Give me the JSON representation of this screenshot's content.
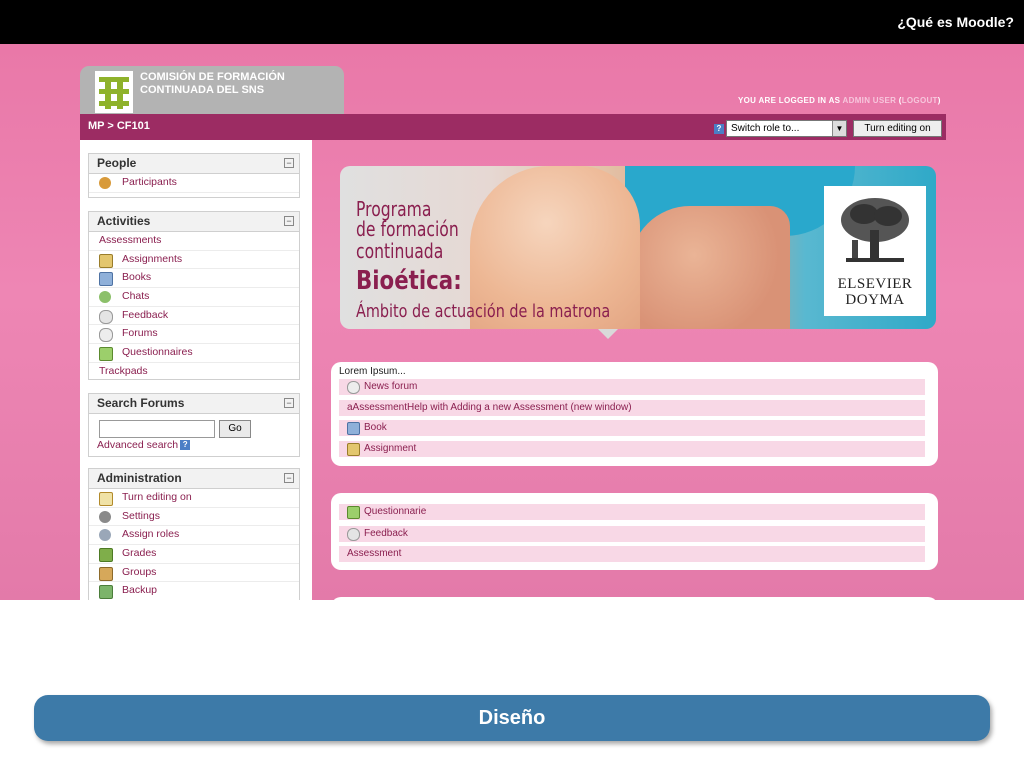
{
  "slide": {
    "title": "¿Qué es Moodle?",
    "caption": "Diseño"
  },
  "header": {
    "logo_text": "COMISIÓN DE FORMACIÓN CONTINUADA DEL SNS",
    "login_prefix": "YOU ARE LOGGED IN AS",
    "login_user": "ADMIN USER",
    "logout_open": "(",
    "logout": "LOGOUT",
    "logout_close": ")"
  },
  "navbar": {
    "breadcrumb": "MP > CF101",
    "help_icon": "?",
    "switch_role": "Switch role to...",
    "turn_editing_button": "Turn editing on"
  },
  "blocks": {
    "people": {
      "title": "People",
      "items": [
        {
          "label": "Participants",
          "icon": "users-icon"
        }
      ]
    },
    "activities": {
      "title": "Activities",
      "items": [
        {
          "label": "Assessments",
          "icon": ""
        },
        {
          "label": "Assignments",
          "icon": "assignment-icon"
        },
        {
          "label": "Books",
          "icon": "book-icon"
        },
        {
          "label": "Chats",
          "icon": "chat-icon"
        },
        {
          "label": "Feedback",
          "icon": "feedback-icon"
        },
        {
          "label": "Forums",
          "icon": "forum-icon"
        },
        {
          "label": "Questionnaires",
          "icon": "questionnaire-icon"
        },
        {
          "label": "Trackpads",
          "icon": ""
        }
      ]
    },
    "search_forums": {
      "title": "Search Forums",
      "go": "Go",
      "advanced": "Advanced search",
      "help": "?"
    },
    "administration": {
      "title": "Administration",
      "items": [
        {
          "label": "Turn editing on",
          "icon": "edit-icon"
        },
        {
          "label": "Settings",
          "icon": "settings-icon"
        },
        {
          "label": "Assign roles",
          "icon": "roles-icon"
        },
        {
          "label": "Grades",
          "icon": "grades-icon"
        },
        {
          "label": "Groups",
          "icon": "groups-icon"
        },
        {
          "label": "Backup",
          "icon": "backup-icon"
        }
      ]
    },
    "collapse_symbol": "−"
  },
  "banner": {
    "line1": "Programa",
    "line2": "de formación",
    "line3": "continuada",
    "title": "Bioética:",
    "subtitle": "Ámbito de actuación de la matrona",
    "publisher_line1": "ELSEVIER",
    "publisher_line2": "DOYMA"
  },
  "section1": {
    "header": "Lorem Ipsum...",
    "items": [
      {
        "label": "News forum",
        "icon": "forum-icon"
      },
      {
        "label": "aAssessmentHelp with Adding a new Assessment (new window)",
        "icon": ""
      },
      {
        "label": "Book",
        "icon": "book-icon"
      },
      {
        "label": "Assignment",
        "icon": "assignment-icon"
      }
    ]
  },
  "section2": {
    "items": [
      {
        "label": "Questionnarie",
        "icon": "questionnaire-icon"
      },
      {
        "label": "Feedback",
        "icon": "feedback-icon"
      },
      {
        "label": "Assessment",
        "icon": ""
      }
    ]
  },
  "colors": {
    "navbar": "#9c2c63",
    "link": "#8a1f4f",
    "background": "#ea7fae",
    "caption_bar": "#3d7aa8"
  }
}
